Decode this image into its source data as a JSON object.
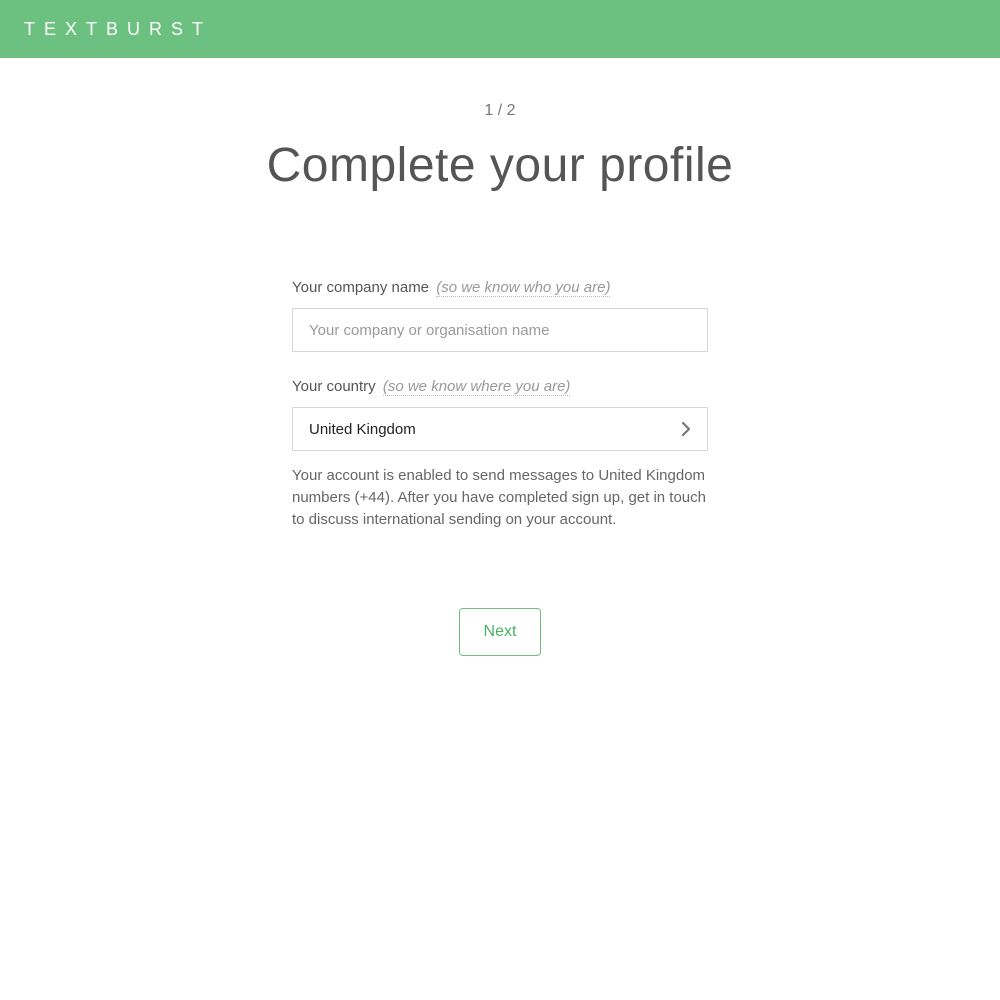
{
  "brand": {
    "name": "TEXTBURST"
  },
  "progress": {
    "label": "1 / 2"
  },
  "page": {
    "title": "Complete your profile"
  },
  "form": {
    "company": {
      "label": "Your company name",
      "hint": "(so we know who you are)",
      "placeholder": "Your company or organisation name",
      "value": ""
    },
    "country": {
      "label": "Your country",
      "hint": "(so we know where you are)",
      "selected": "United Kingdom",
      "help": "Your account is enabled to send messages to United Kingdom numbers (+44). After you have completed sign up, get in touch to discuss international sending on your account."
    }
  },
  "actions": {
    "next": "Next"
  },
  "colors": {
    "accent": "#6cc080"
  }
}
